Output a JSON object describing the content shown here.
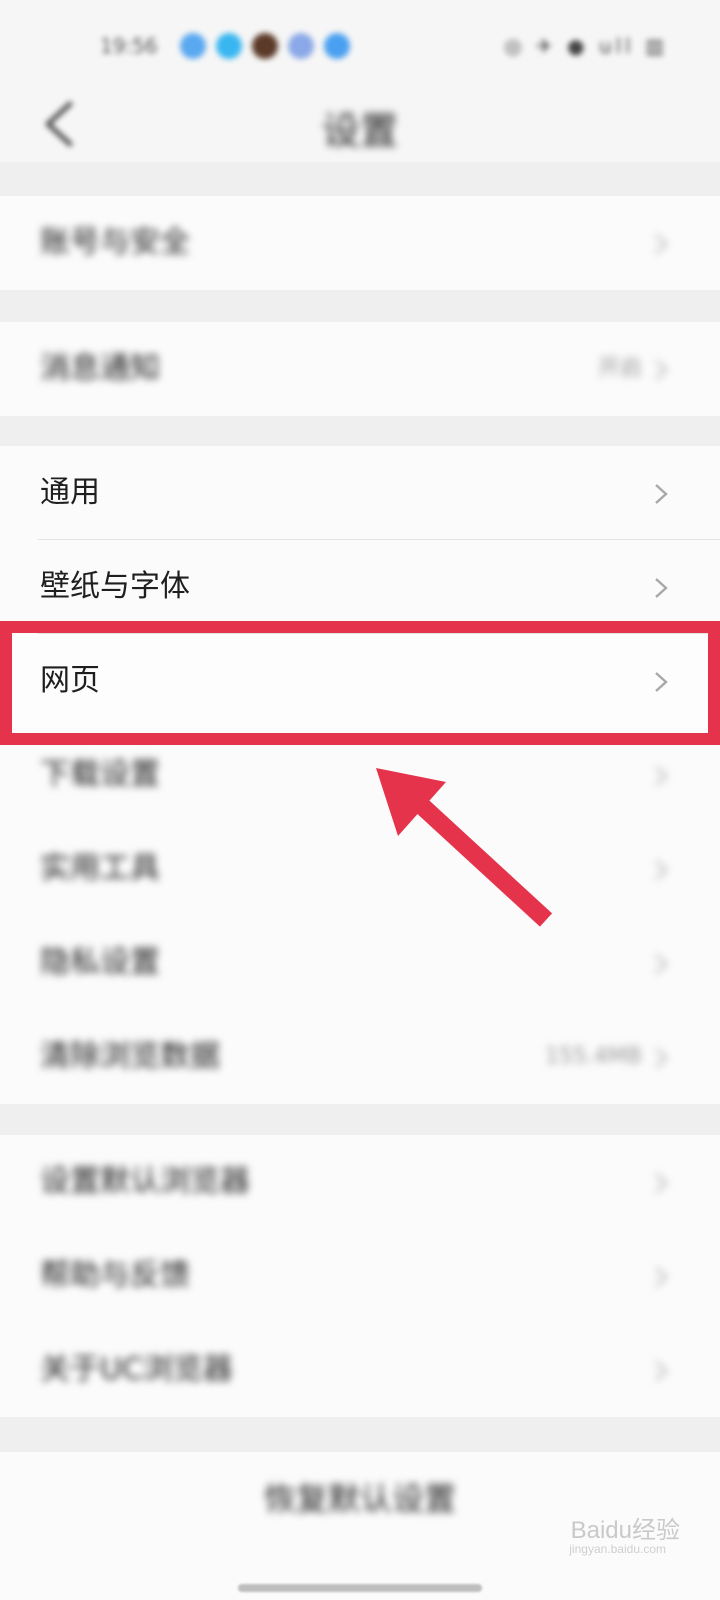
{
  "status_bar": {
    "time": "19:56",
    "icon_colors": [
      "#5aa8f0",
      "#38b6f0",
      "#5b3a29",
      "#8aa8e8",
      "#4aa0f0"
    ],
    "right_text": "◎ ✈ ● ull ▥"
  },
  "nav": {
    "title": "设置"
  },
  "groups": [
    {
      "rows": [
        {
          "label": "账号与安全",
          "value": ""
        }
      ]
    },
    {
      "rows": [
        {
          "label": "消息通知",
          "value": "开启"
        }
      ]
    },
    {
      "rows": [
        {
          "label": "通用",
          "value": ""
        },
        {
          "label": "壁纸与字体",
          "value": ""
        },
        {
          "label": "网页",
          "value": ""
        },
        {
          "label": "下载设置",
          "value": ""
        },
        {
          "label": "实用工具",
          "value": ""
        },
        {
          "label": "隐私设置",
          "value": ""
        },
        {
          "label": "清除浏览数据",
          "value": "155.4MB"
        }
      ]
    },
    {
      "rows": [
        {
          "label": "设置默认浏览器",
          "value": ""
        },
        {
          "label": "帮助与反馈",
          "value": ""
        },
        {
          "label": "关于UC浏览器",
          "value": ""
        }
      ]
    }
  ],
  "reset": {
    "label": "恢复默认设置"
  },
  "watermark": {
    "brand": "Baidu经验",
    "url": "jingyan.baidu.com"
  },
  "highlight_color": "#e5334b"
}
